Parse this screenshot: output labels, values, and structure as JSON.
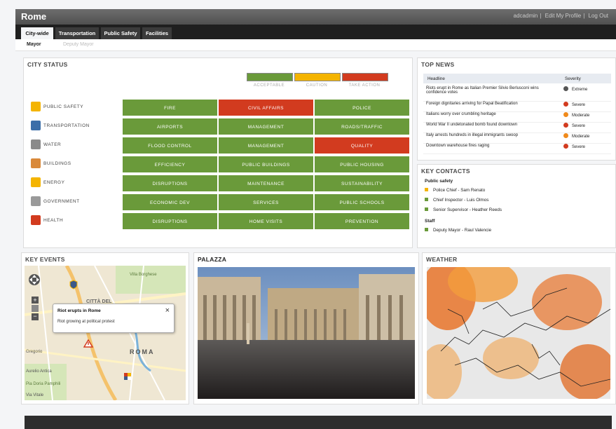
{
  "app": {
    "title": "Rome",
    "user_links": [
      "adcadmin",
      "Edit My Profile",
      "Log Out"
    ]
  },
  "tabs": [
    "City-wide",
    "Transportation",
    "Public Safety",
    "Facilities"
  ],
  "subtabs": [
    "Mayor",
    "Deputy Mayor"
  ],
  "city_status": {
    "title": "CITY STATUS",
    "legend": [
      {
        "label": "ACCEPTABLE",
        "color": "#6a9a3a"
      },
      {
        "label": "CAUTION",
        "color": "#f4b400"
      },
      {
        "label": "TAKE ACTION",
        "color": "#d23b1f"
      }
    ],
    "categories": [
      {
        "name": "PUBLIC SAFETY",
        "icon": "shield-icon",
        "cells": [
          {
            "label": "FIRE",
            "status": "green"
          },
          {
            "label": "CIVIL AFFAIRS",
            "status": "red"
          },
          {
            "label": "POLICE",
            "status": "green"
          }
        ]
      },
      {
        "name": "TRANSPORTATION",
        "icon": "bus-icon",
        "cells": [
          {
            "label": "AIRPORTS",
            "status": "green"
          },
          {
            "label": "MANAGEMENT",
            "status": "green"
          },
          {
            "label": "ROADS/TRAFFIC",
            "status": "green"
          }
        ]
      },
      {
        "name": "WATER",
        "icon": "faucet-icon",
        "cells": [
          {
            "label": "FLOOD CONTROL",
            "status": "green"
          },
          {
            "label": "MANAGEMENT",
            "status": "green"
          },
          {
            "label": "QUALITY",
            "status": "red"
          }
        ]
      },
      {
        "name": "BUILDINGS",
        "icon": "buildings-icon",
        "cells": [
          {
            "label": "EFFICIENCY",
            "status": "green"
          },
          {
            "label": "PUBLIC BUILDINGS",
            "status": "green"
          },
          {
            "label": "PUBLIC HOUSING",
            "status": "green"
          }
        ]
      },
      {
        "name": "ENERGY",
        "icon": "lightning-icon",
        "cells": [
          {
            "label": "DISRUPTIONS",
            "status": "green"
          },
          {
            "label": "MAINTENANCE",
            "status": "green"
          },
          {
            "label": "SUSTAINABILITY",
            "status": "green"
          }
        ]
      },
      {
        "name": "GOVERNMENT",
        "icon": "capitol-icon",
        "cells": [
          {
            "label": "ECONOMIC DEV",
            "status": "green"
          },
          {
            "label": "SERVICES",
            "status": "green"
          },
          {
            "label": "PUBLIC SCHOOLS",
            "status": "green"
          }
        ]
      },
      {
        "name": "HEALTH",
        "icon": "red-cross-icon",
        "cells": [
          {
            "label": "DISRUPTIONS",
            "status": "green"
          },
          {
            "label": "HOME VISITS",
            "status": "green"
          },
          {
            "label": "PREVENTION",
            "status": "green"
          }
        ]
      }
    ]
  },
  "top_news": {
    "title": "TOP NEWS",
    "columns": [
      "Headline",
      "Severity"
    ],
    "rows": [
      {
        "headline": "Riots erupt in Rome as Italian Premier Silvio Berlusconi wins confidence votes",
        "severity": "Extreme",
        "icon": "extreme-icon"
      },
      {
        "headline": "Foreign dignitaries arriving for Papal Beatification",
        "severity": "Severe",
        "icon": "severe-icon"
      },
      {
        "headline": "Italians worry over crumbling heritage",
        "severity": "Moderate",
        "icon": "moderate-icon"
      },
      {
        "headline": "World War II undetonated bomb found downtown",
        "severity": "Severe",
        "icon": "severe-icon"
      },
      {
        "headline": "Italy arrests hundreds in illegal immigrants swoop",
        "severity": "Moderate",
        "icon": "moderate-icon"
      },
      {
        "headline": "Downtown warehouse fires raging",
        "severity": "Severe",
        "icon": "severe-icon"
      }
    ]
  },
  "key_contacts": {
    "title": "KEY CONTACTS",
    "groups": [
      {
        "name": "Public safety",
        "people": [
          {
            "name": "Police Chief - Sam Renato",
            "status": "#f4b400"
          },
          {
            "name": "Chief Inspector - Luis Olmos",
            "status": "#6a9a3a"
          },
          {
            "name": "Senior Supervisor - Heather Reeds",
            "status": "#6a9a3a"
          }
        ]
      },
      {
        "name": "Staff",
        "people": [
          {
            "name": "Deputy Mayor - Raul Valencie",
            "status": "#6a9a3a"
          }
        ]
      }
    ]
  },
  "key_events": {
    "title": "KEY EVENTS",
    "popup": {
      "title": "Riot erupts in Rome",
      "body": "Riot growing at political protest"
    },
    "map_labels": [
      "Villa Borghese",
      "ROMA",
      "Gregorio",
      "Aurelio Antica",
      "Pia Doria Pamphili",
      "Via Vitale",
      "CITTÀ DEL"
    ]
  },
  "palazza": {
    "title": "PALAZZA"
  },
  "weather": {
    "title": "WEATHER"
  }
}
